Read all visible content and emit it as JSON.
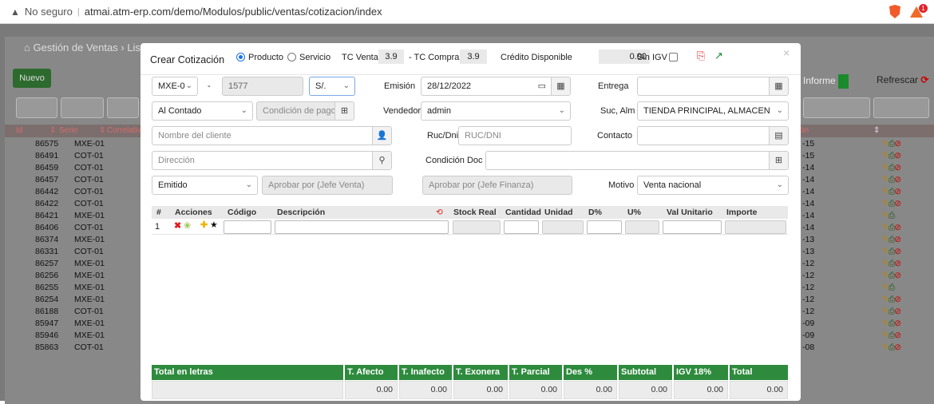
{
  "browser": {
    "security": "No seguro",
    "url": "atmai.atm-erp.com/demo/Modulos/public/ventas/cotizacion/index",
    "ext_badge": "1"
  },
  "background": {
    "breadcrumb": "Gestión de Ventas",
    "breadcrumb_next": "Lis",
    "nuevo": "Nuevo",
    "informe": "Informe",
    "refrescar": "Refrescar",
    "headers": [
      "Id",
      "Serie",
      "Correlativ",
      "ón"
    ],
    "rows": [
      {
        "id": "86575",
        "serie": "MXE-01",
        "d": "-15",
        "acts": "full"
      },
      {
        "id": "86491",
        "serie": "COT-01",
        "d": "-15",
        "acts": "full"
      },
      {
        "id": "86459",
        "serie": "COT-01",
        "d": "-14",
        "acts": "full"
      },
      {
        "id": "86457",
        "serie": "COT-01",
        "d": "-14",
        "acts": "full"
      },
      {
        "id": "86442",
        "serie": "COT-01",
        "d": "-14",
        "acts": "full"
      },
      {
        "id": "86422",
        "serie": "COT-01",
        "d": "-14",
        "acts": "full"
      },
      {
        "id": "86421",
        "serie": "MXE-01",
        "d": "-14",
        "acts": "short"
      },
      {
        "id": "86406",
        "serie": "COT-01",
        "d": "-14",
        "acts": "full"
      },
      {
        "id": "86374",
        "serie": "MXE-01",
        "d": "-13",
        "acts": "full"
      },
      {
        "id": "86331",
        "serie": "COT-01",
        "d": "-13",
        "acts": "full"
      },
      {
        "id": "86257",
        "serie": "MXE-01",
        "d": "-12",
        "acts": "full"
      },
      {
        "id": "86256",
        "serie": "MXE-01",
        "d": "-12",
        "acts": "full"
      },
      {
        "id": "86255",
        "serie": "MXE-01",
        "d": "-12",
        "acts": "short"
      },
      {
        "id": "86254",
        "serie": "MXE-01",
        "d": "-12",
        "acts": "full"
      },
      {
        "id": "86188",
        "serie": "COT-01",
        "d": "-12",
        "acts": "full"
      },
      {
        "id": "85947",
        "serie": "MXE-01",
        "d": "-09",
        "acts": "full"
      },
      {
        "id": "85946",
        "serie": "MXE-01",
        "d": "-09",
        "acts": "full"
      },
      {
        "id": "85863",
        "serie": "COT-01",
        "d": "-08",
        "acts": "full"
      }
    ]
  },
  "modal": {
    "title": "Crear Cotización",
    "radio_producto": "Producto",
    "radio_servicio": "Servicio",
    "tc_venta_label": "TC Venta",
    "tc_venta": "3.9",
    "tc_compra_label": "- TC Compra",
    "tc_compra": "3.9",
    "credito_label": "Crédito Disponible",
    "credito": "0.00",
    "sin_igv": "Sin IGV",
    "close": "×",
    "serie": "MXE-0",
    "dash": "-",
    "correlativo": "1577",
    "moneda": "S/.",
    "emision_label": "Emisión",
    "emision": "28/12/2022",
    "entrega_label": "Entrega",
    "pago": "Al Contado",
    "condicion_pago_ph": "Condición de pago",
    "vendedor_label": "Vendedor",
    "vendedor": "admin",
    "suc_label": "Suc, Alm",
    "sucursal": "TIENDA PRINCIPAL, ALMACEN",
    "cliente_ph": "Nombre del cliente",
    "ruc_label": "Ruc/Dni",
    "ruc_ph": "RUC/DNI",
    "contacto_label": "Contacto",
    "direccion_ph": "Dirección",
    "condicion_doc_label": "Condición Doc",
    "estado": "Emitido",
    "aprobar_venta_ph": "Aprobar por (Jefe Venta)",
    "aprobar_finanza_ph": "Aprobar por (Jefe Finanza)",
    "motivo_label": "Motivo",
    "motivo": "Venta nacional"
  },
  "items": {
    "headers": {
      "num": "#",
      "acciones": "Acciones",
      "codigo": "Código",
      "descripcion": "Descripción",
      "stock": "Stock Real",
      "cantidad": "Cantidad",
      "unidad": "Unidad",
      "d": "D%",
      "u": "U%",
      "val_unitario": "Val Unitario",
      "importe": "Importe"
    },
    "row_num": "1"
  },
  "totals": {
    "letras_label": "Total en letras",
    "afecto_label": "T. Afecto",
    "afecto": "0.00",
    "inafecto_label": "T. Inafecto",
    "inafecto": "0.00",
    "exonera_label": "T. Exonera",
    "exonera": "0.00",
    "parcial_label": "T. Parcial",
    "parcial": "0.00",
    "des_label": "Des %",
    "des": "0.00",
    "subtotal_label": "Subtotal",
    "subtotal": "0.00",
    "igv_label": "IGV 18%",
    "igv": "0.00",
    "total_label": "Total",
    "total": "0.00"
  },
  "colors": {
    "accent": "#1a73e8",
    "green": "#2e8b3e",
    "danger": "#e02020"
  }
}
